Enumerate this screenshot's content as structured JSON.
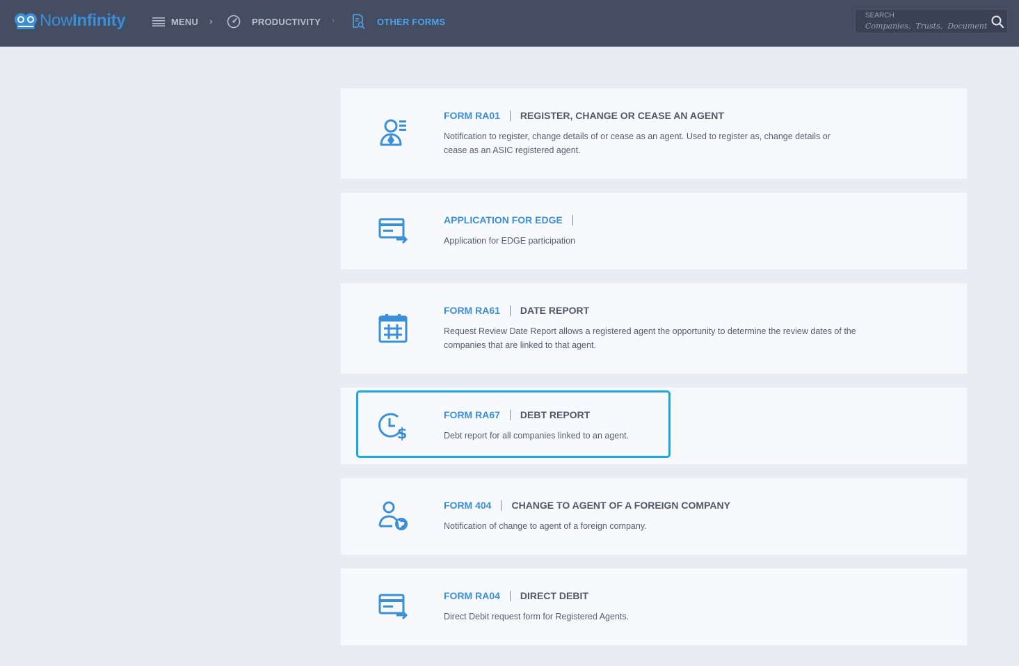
{
  "app": {
    "logo_text_light": "Now",
    "logo_text_bold": "Infinity",
    "brand_color": "#3a8fd9"
  },
  "nav": {
    "menu_label": "MENU",
    "productivity_label": "PRODUCTIVITY",
    "current_label": "OTHER FORMS",
    "chevron": "›"
  },
  "search": {
    "label": "SEARCH",
    "placeholder": "Companies,  Trusts,  Documents"
  },
  "forms": [
    {
      "icon": "agent-register-icon",
      "code": "FORM RA01",
      "title": "REGISTER, CHANGE OR CEASE AN AGENT",
      "description": "Notification to register, change details of or cease as an agent. Used to register as, change details or cease as an ASIC registered agent."
    },
    {
      "icon": "card-transfer-icon",
      "code": "APPLICATION FOR EDGE",
      "title": "",
      "description": "Application for EDGE participation"
    },
    {
      "icon": "calendar-icon",
      "code": "FORM RA61",
      "title": "DATE REPORT",
      "description": "Request Review Date Report allows a registered agent the opportunity to determine the review dates of the companies that are linked to that agent."
    },
    {
      "icon": "clock-dollar-icon",
      "code": "FORM RA67",
      "title": "DEBT REPORT",
      "description": "Debt report for all companies linked to an agent."
    },
    {
      "icon": "agent-globe-icon",
      "code": "FORM 404",
      "title": "CHANGE TO AGENT OF A FOREIGN COMPANY",
      "description": "Notification of change to agent of a foreign company."
    },
    {
      "icon": "card-transfer-icon",
      "code": "FORM RA04",
      "title": "DIRECT DEBIT",
      "description": "Direct Debit request form for Registered Agents."
    }
  ],
  "highlight_color": "#19a9e0"
}
